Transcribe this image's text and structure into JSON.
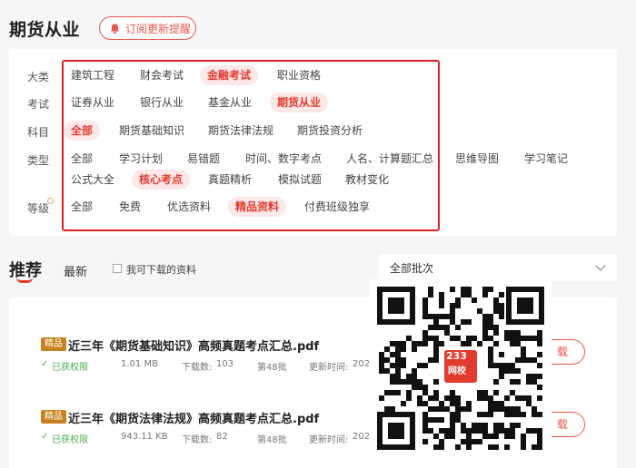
{
  "header": {
    "title": "期货从业",
    "subscribe_label": "订阅更新提醒"
  },
  "filters": {
    "rows": [
      {
        "label": "大类",
        "tags": [
          "建筑工程",
          "财会考试",
          "金融考试",
          "职业资格"
        ],
        "active": 2
      },
      {
        "label": "考试",
        "tags": [
          "证券从业",
          "银行从业",
          "基金从业",
          "期货从业"
        ],
        "active": 3
      },
      {
        "label": "科目",
        "tags": [
          "全部",
          "期货基础知识",
          "期货法律法规",
          "期货投资分析"
        ],
        "active": 0
      },
      {
        "label": "类型",
        "tags": [
          "全部",
          "学习计划",
          "易错题",
          "时间、数字考点",
          "人名、计算题汇总",
          "思维导图",
          "学习笔记",
          "公式大全",
          "核心考点",
          "真题精析",
          "模拟试题",
          "教材变化"
        ],
        "active": 8
      },
      {
        "label": "等级",
        "tags": [
          "全部",
          "免费",
          "优选资料",
          "精品资料",
          "付费班级独享"
        ],
        "active": 3
      }
    ]
  },
  "tabs": {
    "recommend": "推荐",
    "latest": "最新",
    "downloadable_label": "我可下载的资料"
  },
  "batch_select": {
    "value": "全部批次"
  },
  "documents": [
    {
      "badge": "精品",
      "title": "近三年《期货基础知识》高频真题考点汇总.pdf",
      "status": "已获权限",
      "size": "1.01 MB",
      "downloads_label": "下载数:",
      "downloads": "103",
      "batch": "第48批",
      "updated_label": "更新时间:",
      "updated": "2024-0",
      "action": "载"
    },
    {
      "badge": "精品",
      "title": "近三年《期货法律法规》高频真题考点汇总.pdf",
      "status": "已获权限",
      "size": "943.11 KB",
      "downloads_label": "下载数:",
      "downloads": "82",
      "batch": "第48批",
      "updated_label": "更新时间:",
      "updated": "2024-",
      "action": "载"
    }
  ],
  "qr": {
    "logo_line1": "233",
    "logo_line2": "网校"
  },
  "colors": {
    "accent": "#e23b30",
    "badge": "#c7821e",
    "highlight_box": "#e02020"
  }
}
